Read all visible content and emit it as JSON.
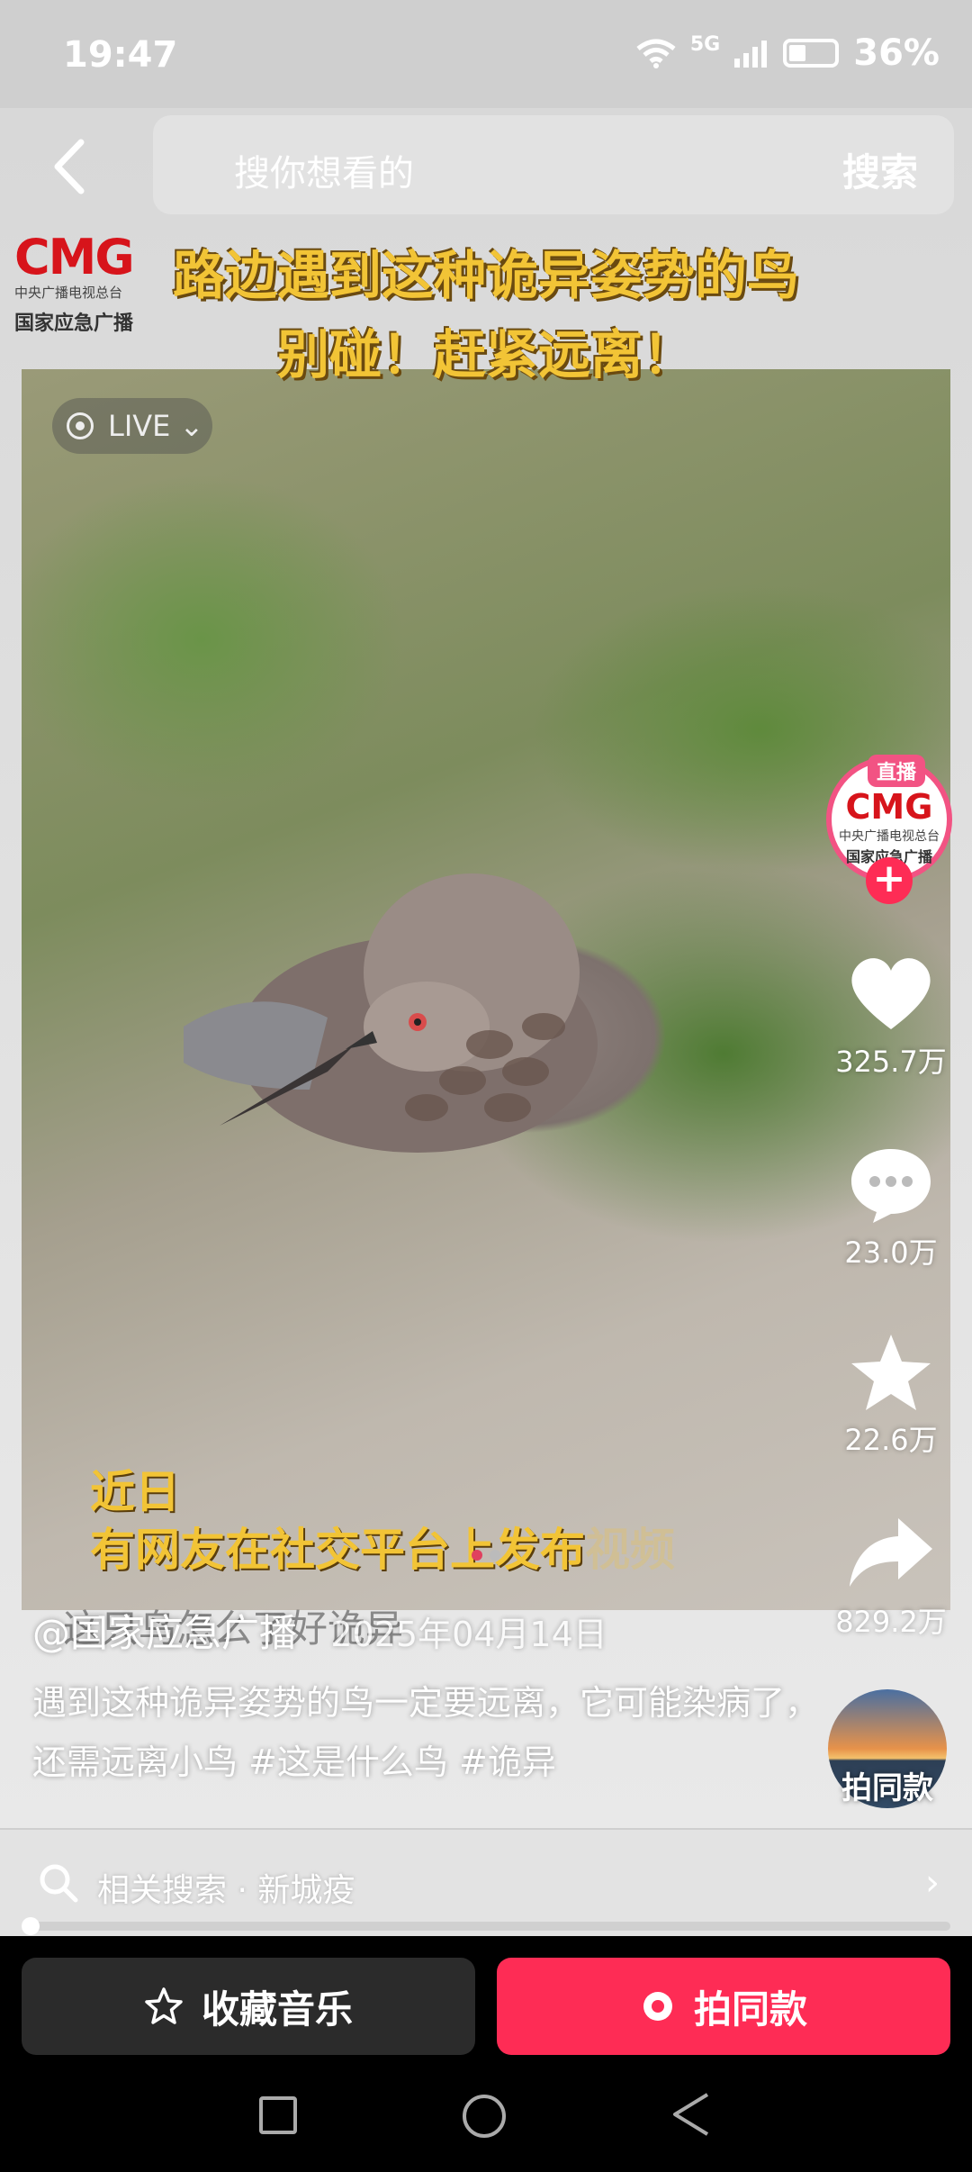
{
  "status": {
    "time": "19:47",
    "network": "5G",
    "battery": "36%"
  },
  "header": {
    "search_placeholder": "搜你想看的",
    "search_button": "搜索",
    "overlay_title_line1": "路边遇到这种诡异姿势的鸟",
    "overlay_title_line2": "别碰！赶紧远离！"
  },
  "logo": {
    "brand": "CMG",
    "sub1": "中央广播电视总台",
    "sub2": "国家应急广播"
  },
  "live_badge": "LIVE",
  "video_caption": {
    "line1": "近日",
    "line2": "有网友在社交平台上发布",
    "line2_faint": "视频"
  },
  "rail": {
    "avatar_tag": "直播",
    "avatar_brand": "CMG",
    "avatar_sub1": "中央广播电视总台",
    "avatar_sub2": "国家应急广播",
    "likes": "325.7万",
    "comments": "23.0万",
    "favorites": "22.6万",
    "shares": "829.2万",
    "same_label": "拍同款"
  },
  "post": {
    "ghost_text": "这只鸟怎么了好诡异",
    "author": "@国家应急广播",
    "date": "2025年04月14日",
    "description": "遇到这种诡异姿势的鸟一定要远离，它可能染病了，还需远离小鸟 #这是什么鸟 #诡异"
  },
  "carousel": {
    "total": 2,
    "active": 0
  },
  "related": {
    "label": "相关搜索 · 新城疫"
  },
  "progress": {
    "fraction": 0.01
  },
  "bottom": {
    "left_button": "收藏音乐",
    "right_button": "拍同款"
  },
  "colors": {
    "accent": "#fe2c55",
    "caption": "#f2c436",
    "brand_red": "#d7141b"
  }
}
